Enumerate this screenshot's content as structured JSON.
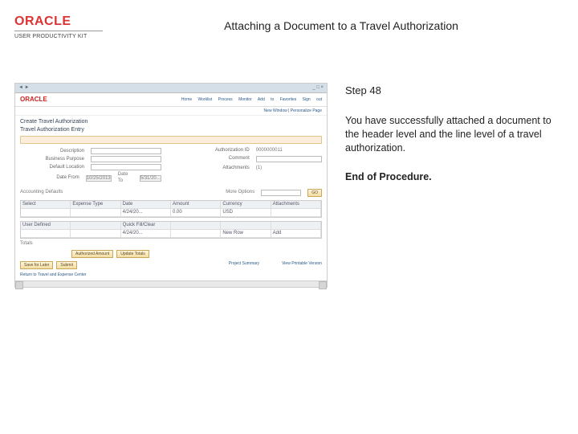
{
  "header": {
    "brand": "ORACLE",
    "brand_sub": "USER PRODUCTIVITY KIT",
    "title": "Attaching a Document to a Travel Authorization"
  },
  "instruction": {
    "step_heading": "Step 48",
    "body": "You have successfully attached a document to the header level and the line level of a travel authorization.",
    "end": "End of Procedure."
  },
  "shot": {
    "topbar": {
      "left": "",
      "tabs": "",
      "right": ""
    },
    "oracle": "ORACLE",
    "topnav": "Home Worklist Process Monitor Add to Favorites Sign out",
    "breadcrumb": "New Window | Personalize Page",
    "h1": "Create Travel Authorization",
    "h2": "Travel Authorization Entry",
    "alert": "",
    "fields": {
      "desc_lbl": "Description",
      "authid_lbl": "Authorization ID",
      "bp_lbl": "Business Purpose",
      "comment_lbl": "Comment",
      "default_lbl": "Default Location",
      "datefrom_lbl": "Date From",
      "dateto_lbl": "Date To",
      "attach_lbl": "Attachments",
      "datefrom_val": "10/25/2013",
      "dateto_val": "5/31/20..."
    },
    "section": "Accounting Defaults",
    "morehdr": "More Options",
    "go": "GO",
    "grid1": {
      "head": [
        "Select",
        "Expense Type",
        "Date",
        "Amount",
        "Currency",
        "Attachments"
      ],
      "row": [
        "",
        "",
        "4/24/20...",
        "0.00",
        "USD",
        ""
      ]
    },
    "grid2": {
      "head": [
        "User Defined",
        "Quick Fill/Clear"
      ],
      "row": [
        "",
        "",
        "4/24/20...",
        "",
        "New Row",
        "Add"
      ]
    },
    "btns_lower": [
      "Authorized Amount",
      "Update Totals"
    ],
    "totals_lbl": "Totals",
    "btns_final": [
      "Save for Later",
      "Submit"
    ],
    "right_links": "Project Summary",
    "right_links2": "View Printable Version",
    "policy": "Return to Travel and Expense Center"
  }
}
